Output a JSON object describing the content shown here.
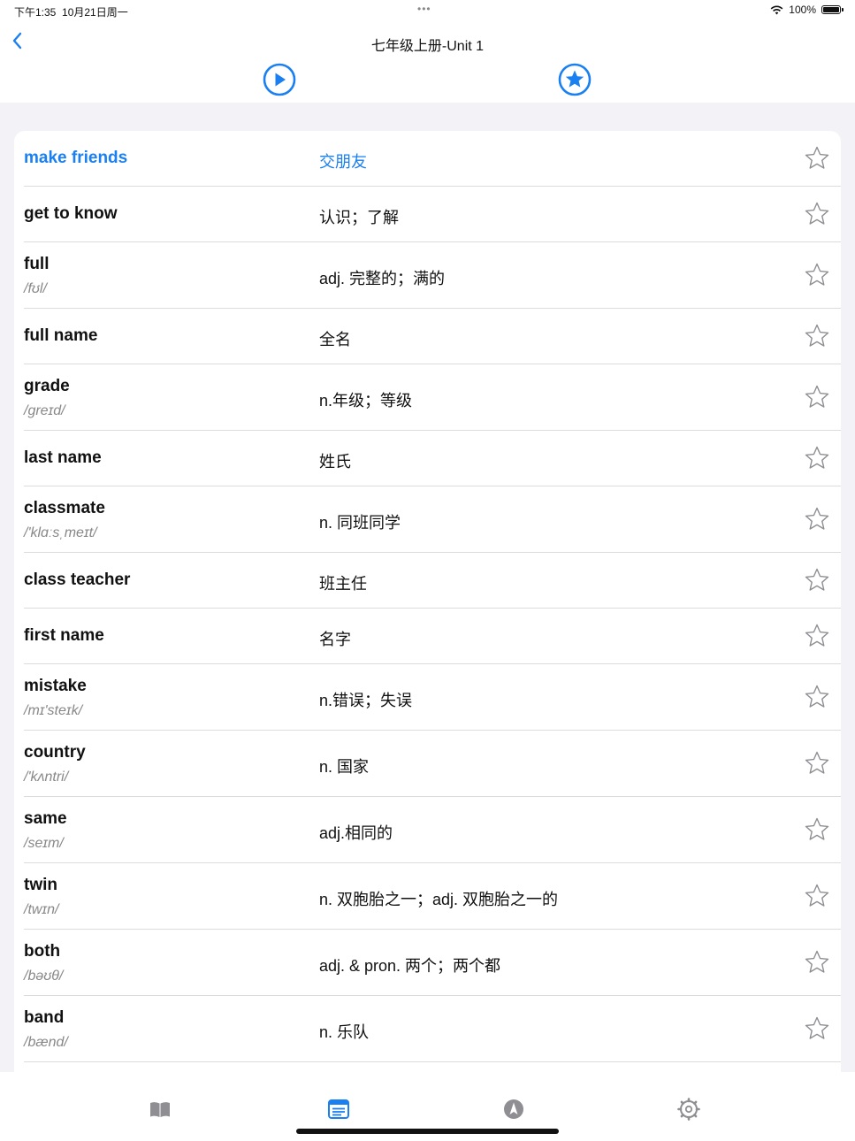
{
  "status": {
    "time": "下午1:35",
    "date": "10月21日周一",
    "battery": "100%",
    "battery_level": 1.0
  },
  "nav": {
    "title": "七年级上册-Unit 1"
  },
  "icons": {
    "back": "chevron-left-icon",
    "play": "play-circle-icon",
    "favorite": "star-circle-icon",
    "word_star": "star-outline-icon"
  },
  "colors": {
    "accent": "#1a7ff0",
    "phonetic": "#888888"
  },
  "words": [
    {
      "en": "make friends",
      "phonetic": "",
      "cn": "交朋友",
      "highlight": true
    },
    {
      "en": "get to know",
      "phonetic": "",
      "cn": "认识；了解"
    },
    {
      "en": "full",
      "phonetic": "/fʊl/",
      "cn": "adj. 完整的；满的"
    },
    {
      "en": "full name",
      "phonetic": "",
      "cn": "全名"
    },
    {
      "en": "grade",
      "phonetic": "/greɪd/",
      "cn": "n.年级；等级"
    },
    {
      "en": "last name",
      "phonetic": "",
      "cn": "姓氏"
    },
    {
      "en": "classmate",
      "phonetic": "/'klɑːsˌmeɪt/",
      "cn": "n. 同班同学"
    },
    {
      "en": "class teacher",
      "phonetic": "",
      "cn": "班主任"
    },
    {
      "en": "first name",
      "phonetic": "",
      "cn": "名字"
    },
    {
      "en": "mistake",
      "phonetic": "/mɪ'steɪk/",
      "cn": "n.错误；失误"
    },
    {
      "en": "country",
      "phonetic": "/'kʌntri/",
      "cn": "n. 国家"
    },
    {
      "en": "same",
      "phonetic": "/seɪm/",
      "cn": "adj.相同的"
    },
    {
      "en": "twin",
      "phonetic": "/twɪn/",
      "cn": "n. 双胞胎之一；adj. 双胞胎之一的"
    },
    {
      "en": "both",
      "phonetic": "/bəʊθ/",
      "cn": "adj. & pron. 两个；两个都"
    },
    {
      "en": "band",
      "phonetic": "/bænd/",
      "cn": "n. 乐队"
    }
  ],
  "tabs": [
    {
      "icon": "book-icon",
      "active": false
    },
    {
      "icon": "list-icon",
      "active": true
    },
    {
      "icon": "compass-icon",
      "active": false
    },
    {
      "icon": "gear-icon",
      "active": false
    }
  ]
}
